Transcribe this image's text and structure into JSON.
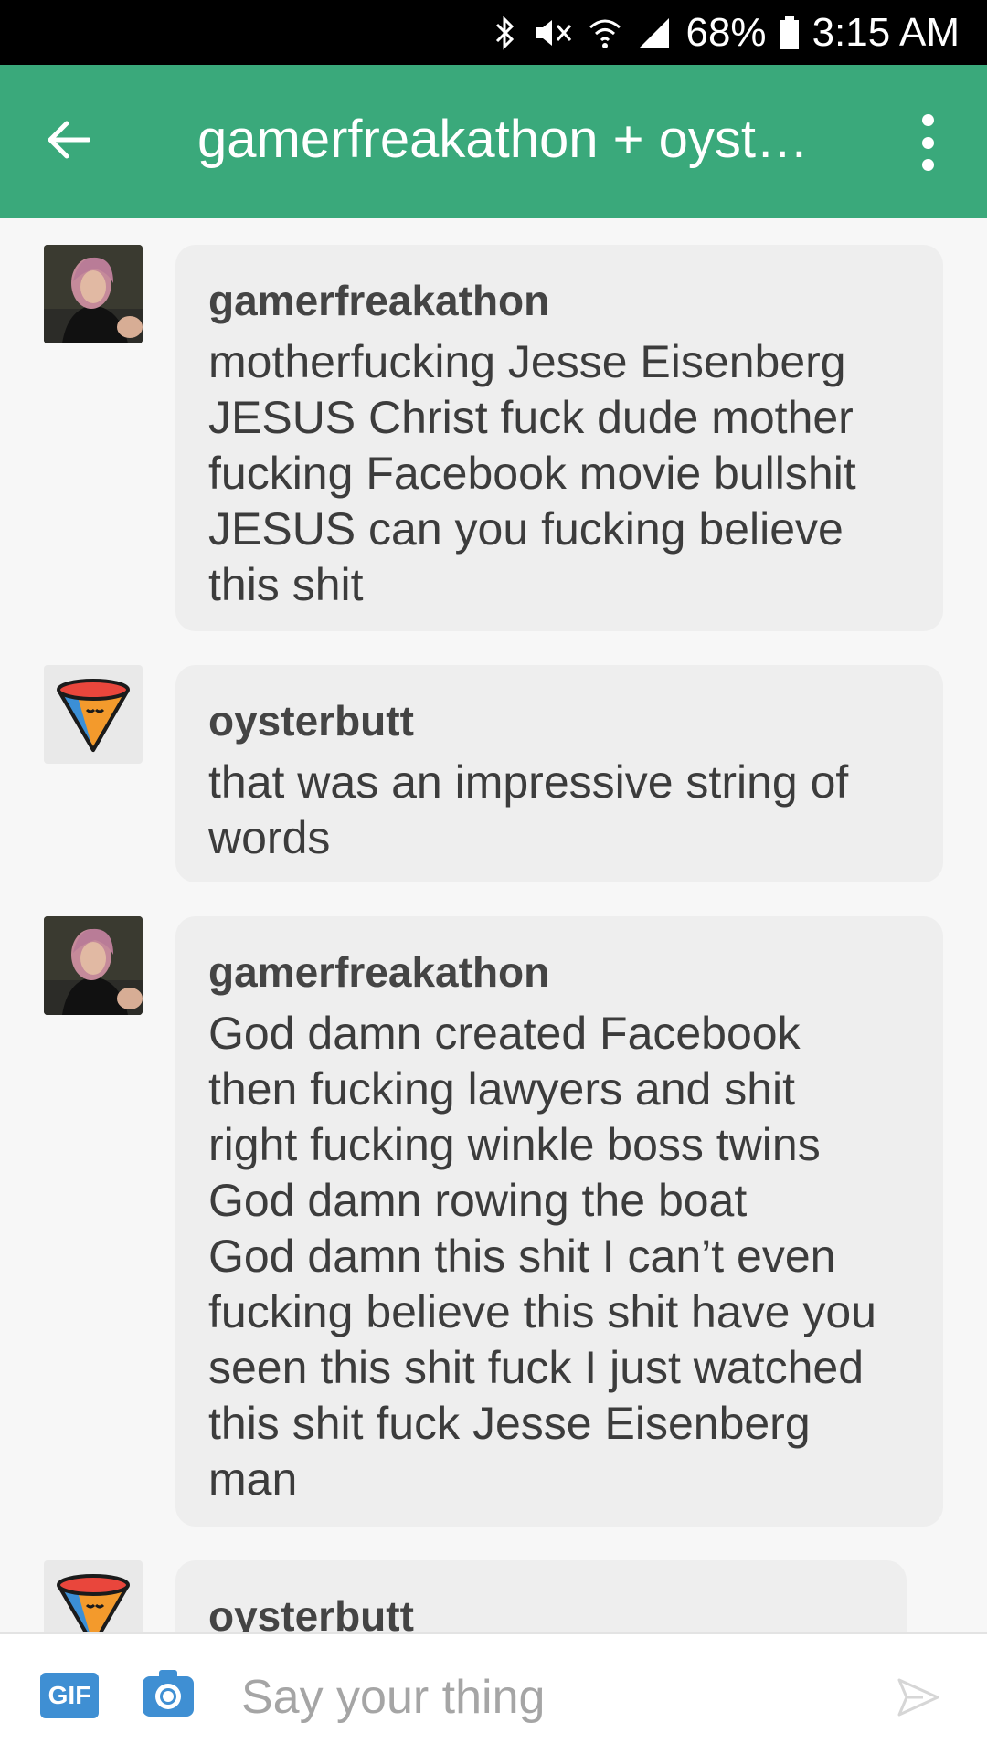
{
  "status_bar": {
    "battery": "68%",
    "time": "3:15 AM",
    "icons": [
      "bluetooth-icon",
      "mute-icon",
      "wifi-icon",
      "signal-icon",
      "battery-icon"
    ]
  },
  "header": {
    "title": "gamerfreakathon + oyst…",
    "back_icon": "arrow-left-icon",
    "menu_icon": "more-vertical-icon"
  },
  "messages": [
    {
      "author": "gamerfreakathon",
      "avatar": "photo-avatar",
      "text": "motherfucking Jesse Eisenberg\nJESUS Christ fuck dude mother\nfucking Facebook movie bullshit\nJESUS can you fucking believe\nthis shit"
    },
    {
      "author": "oysterbutt",
      "avatar": "cone-avatar",
      "text": "that was an impressive string of\nwords"
    },
    {
      "author": "gamerfreakathon",
      "avatar": "photo-avatar",
      "text": "God damn created Facebook\nthen fucking lawyers and shit\nright fucking winkle boss twins\nGod damn rowing the boat\nGod damn this shit I can’t even\nfucking believe this shit have you\nseen this shit fuck I just watched\nthis shit fuck Jesse Eisenberg\nman"
    },
    {
      "author": "oysterbutt",
      "avatar": "cone-avatar",
      "text": ""
    }
  ],
  "composer": {
    "gif_label": "GIF",
    "placeholder": "Say your thing",
    "camera_icon": "camera-icon",
    "send_icon": "send-icon"
  },
  "colors": {
    "app_bar": "#3aa97b",
    "bubble": "#eeeeee",
    "gif_button": "#3f8fd3"
  }
}
